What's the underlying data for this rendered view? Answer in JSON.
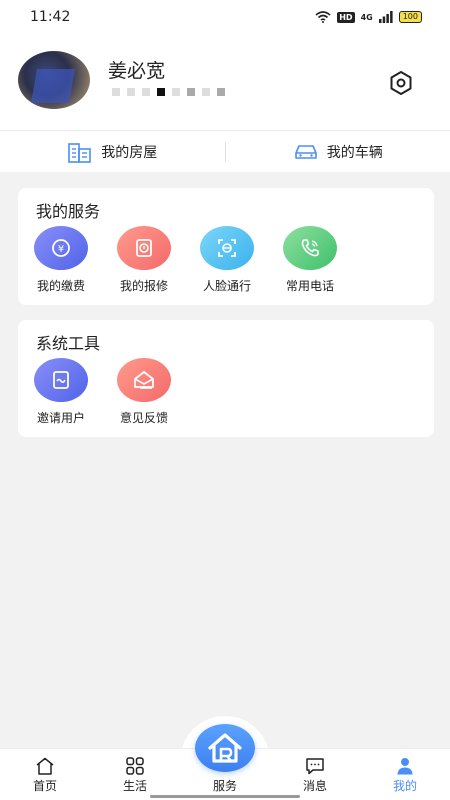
{
  "status_bar": {
    "time": "11:42",
    "hd": "HD",
    "network": "4G",
    "battery": "100"
  },
  "profile": {
    "name": "姜必宽"
  },
  "quick_links": [
    {
      "label": "我的房屋",
      "icon": "building-icon"
    },
    {
      "label": "我的车辆",
      "icon": "car-icon"
    }
  ],
  "services": {
    "title": "我的服务",
    "items": [
      {
        "label": "我的缴费",
        "icon": "payment-icon",
        "color_from": "#8a8ff7",
        "color_to": "#4f63e9"
      },
      {
        "label": "我的报修",
        "icon": "repair-icon",
        "color_from": "#ff9a8c",
        "color_to": "#f46a6a"
      },
      {
        "label": "人脸通行",
        "icon": "face-scan-icon",
        "color_from": "#7cd6f8",
        "color_to": "#3ab2ee"
      },
      {
        "label": "常用电话",
        "icon": "phone-icon",
        "color_from": "#8de0a0",
        "color_to": "#3fc06a"
      }
    ]
  },
  "tools": {
    "title": "系统工具",
    "items": [
      {
        "label": "邀请用户",
        "icon": "invite-icon",
        "color_from": "#8a8ff7",
        "color_to": "#4f63e9"
      },
      {
        "label": "意见反馈",
        "icon": "feedback-icon",
        "color_from": "#ff9a8c",
        "color_to": "#f46a6a"
      }
    ]
  },
  "tab_bar": {
    "items": [
      {
        "label": "首页",
        "icon": "home-icon"
      },
      {
        "label": "生活",
        "icon": "grid-icon"
      },
      {
        "label": "服务",
        "icon": "service-house-icon"
      },
      {
        "label": "消息",
        "icon": "message-icon"
      },
      {
        "label": "我的",
        "icon": "user-icon"
      }
    ],
    "active": "我的",
    "active_color": "#4a8ff5"
  }
}
